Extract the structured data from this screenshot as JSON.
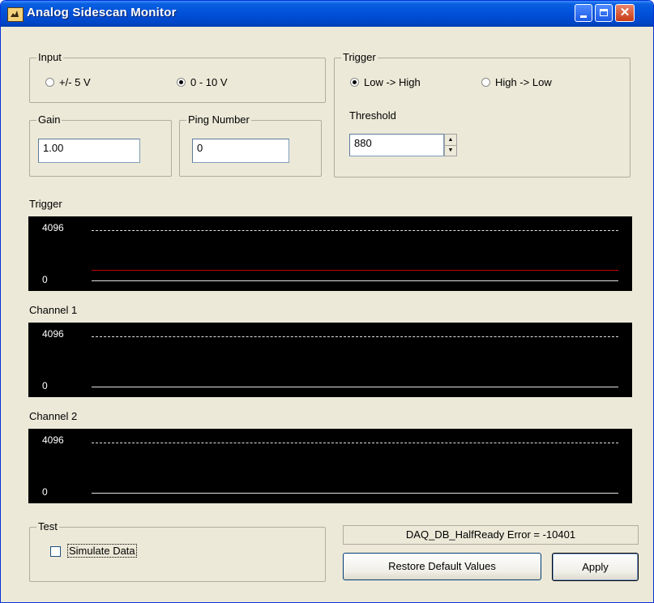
{
  "window": {
    "title": "Analog Sidescan Monitor",
    "min_glyph": "",
    "max_glyph": "",
    "close_glyph": "✕"
  },
  "input": {
    "label": "Input",
    "options": [
      "+/- 5 V",
      "0 - 10 V"
    ],
    "selected": "0 - 10 V"
  },
  "trigger": {
    "label": "Trigger",
    "options": [
      "Low -> High",
      "High -> Low"
    ],
    "selected": "Low -> High",
    "threshold_label": "Threshold",
    "threshold_value": "880"
  },
  "gain": {
    "label": "Gain",
    "value": "1.00"
  },
  "ping": {
    "label": "Ping Number",
    "value": "0"
  },
  "plots": [
    {
      "label": "Trigger",
      "ymax": "4096",
      "ymin": "0",
      "threshold": 880
    },
    {
      "label": "Channel 1",
      "ymax": "4096",
      "ymin": "0"
    },
    {
      "label": "Channel 2",
      "ymax": "4096",
      "ymin": "0"
    }
  ],
  "test": {
    "label": "Test",
    "simulate_label": "Simulate Data",
    "simulate_checked": false
  },
  "status": "DAQ_DB_HalfReady Error = -10401",
  "buttons": {
    "restore": "Restore Default Values",
    "apply": "Apply"
  },
  "colors": {
    "title_bar": "#0050d8",
    "plot_bg": "#000000",
    "threshold_line": "#c40000"
  }
}
